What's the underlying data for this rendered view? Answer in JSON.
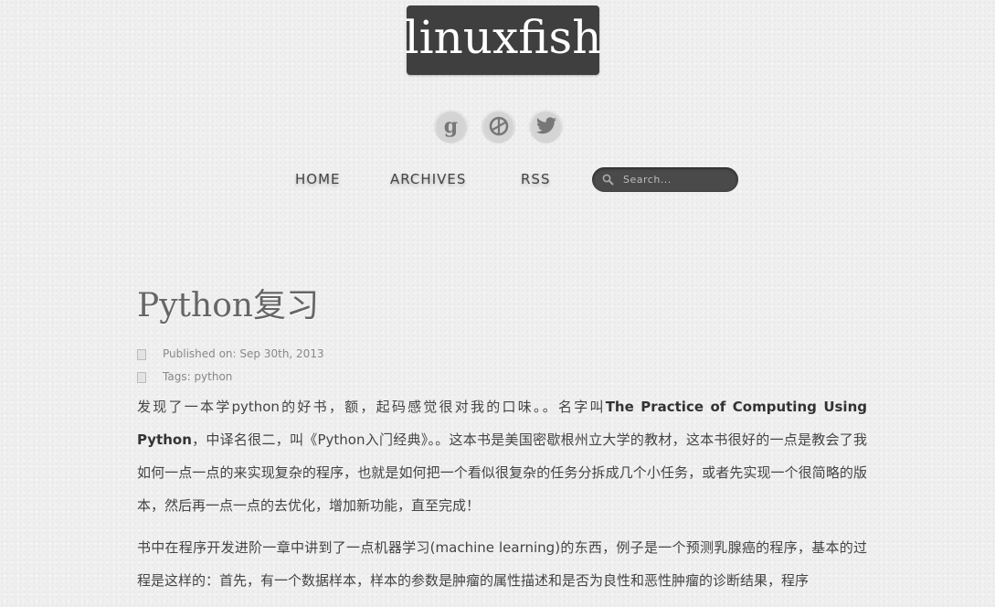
{
  "site": {
    "logo_text": "linuxfish"
  },
  "social": [
    {
      "name": "google-plus",
      "glyph": "g"
    },
    {
      "name": "picasa"
    },
    {
      "name": "twitter"
    }
  ],
  "nav": {
    "items": [
      "HOME",
      "ARCHIVES",
      "RSS"
    ],
    "search_placeholder": "Search..."
  },
  "post": {
    "title": "Python复习",
    "published_label": "Published on:",
    "published_date": "Sep 30th, 2013",
    "tags_label": "Tags:",
    "tag": "python",
    "p1_a": "发现了一本学python的好书，额，起码感觉很对我的口味。。名字叫",
    "p1_book_en": "The Practice of Computing Using Python",
    "p1_b": "，中译名很二，叫《Python入门经典》。。这本书是美国密歇根州立大学的教材，这本书很好的一点是教会了我如何一点一点的来实现复杂的程序，也就是如何把一个看似很复杂的任务分拆成几个小任务，或者先实现一个很简略的版本，然后再一点一点的去优化，增加新功能，直至完成！",
    "p2": "书中在程序开发进阶一章中讲到了一点机器学习(machine learning)的东西，例子是一个预测乳腺癌的程序，基本的过程是这样的：首先，有一个数据样本，样本的参数是肿瘤的属性描述和是否为良性和恶性肿瘤的诊断结果，程序"
  },
  "colors": {
    "background": "#efefef",
    "logo_bg": "#3f3f3f",
    "search_bg": "#4a4a4a",
    "text": "#444444"
  }
}
